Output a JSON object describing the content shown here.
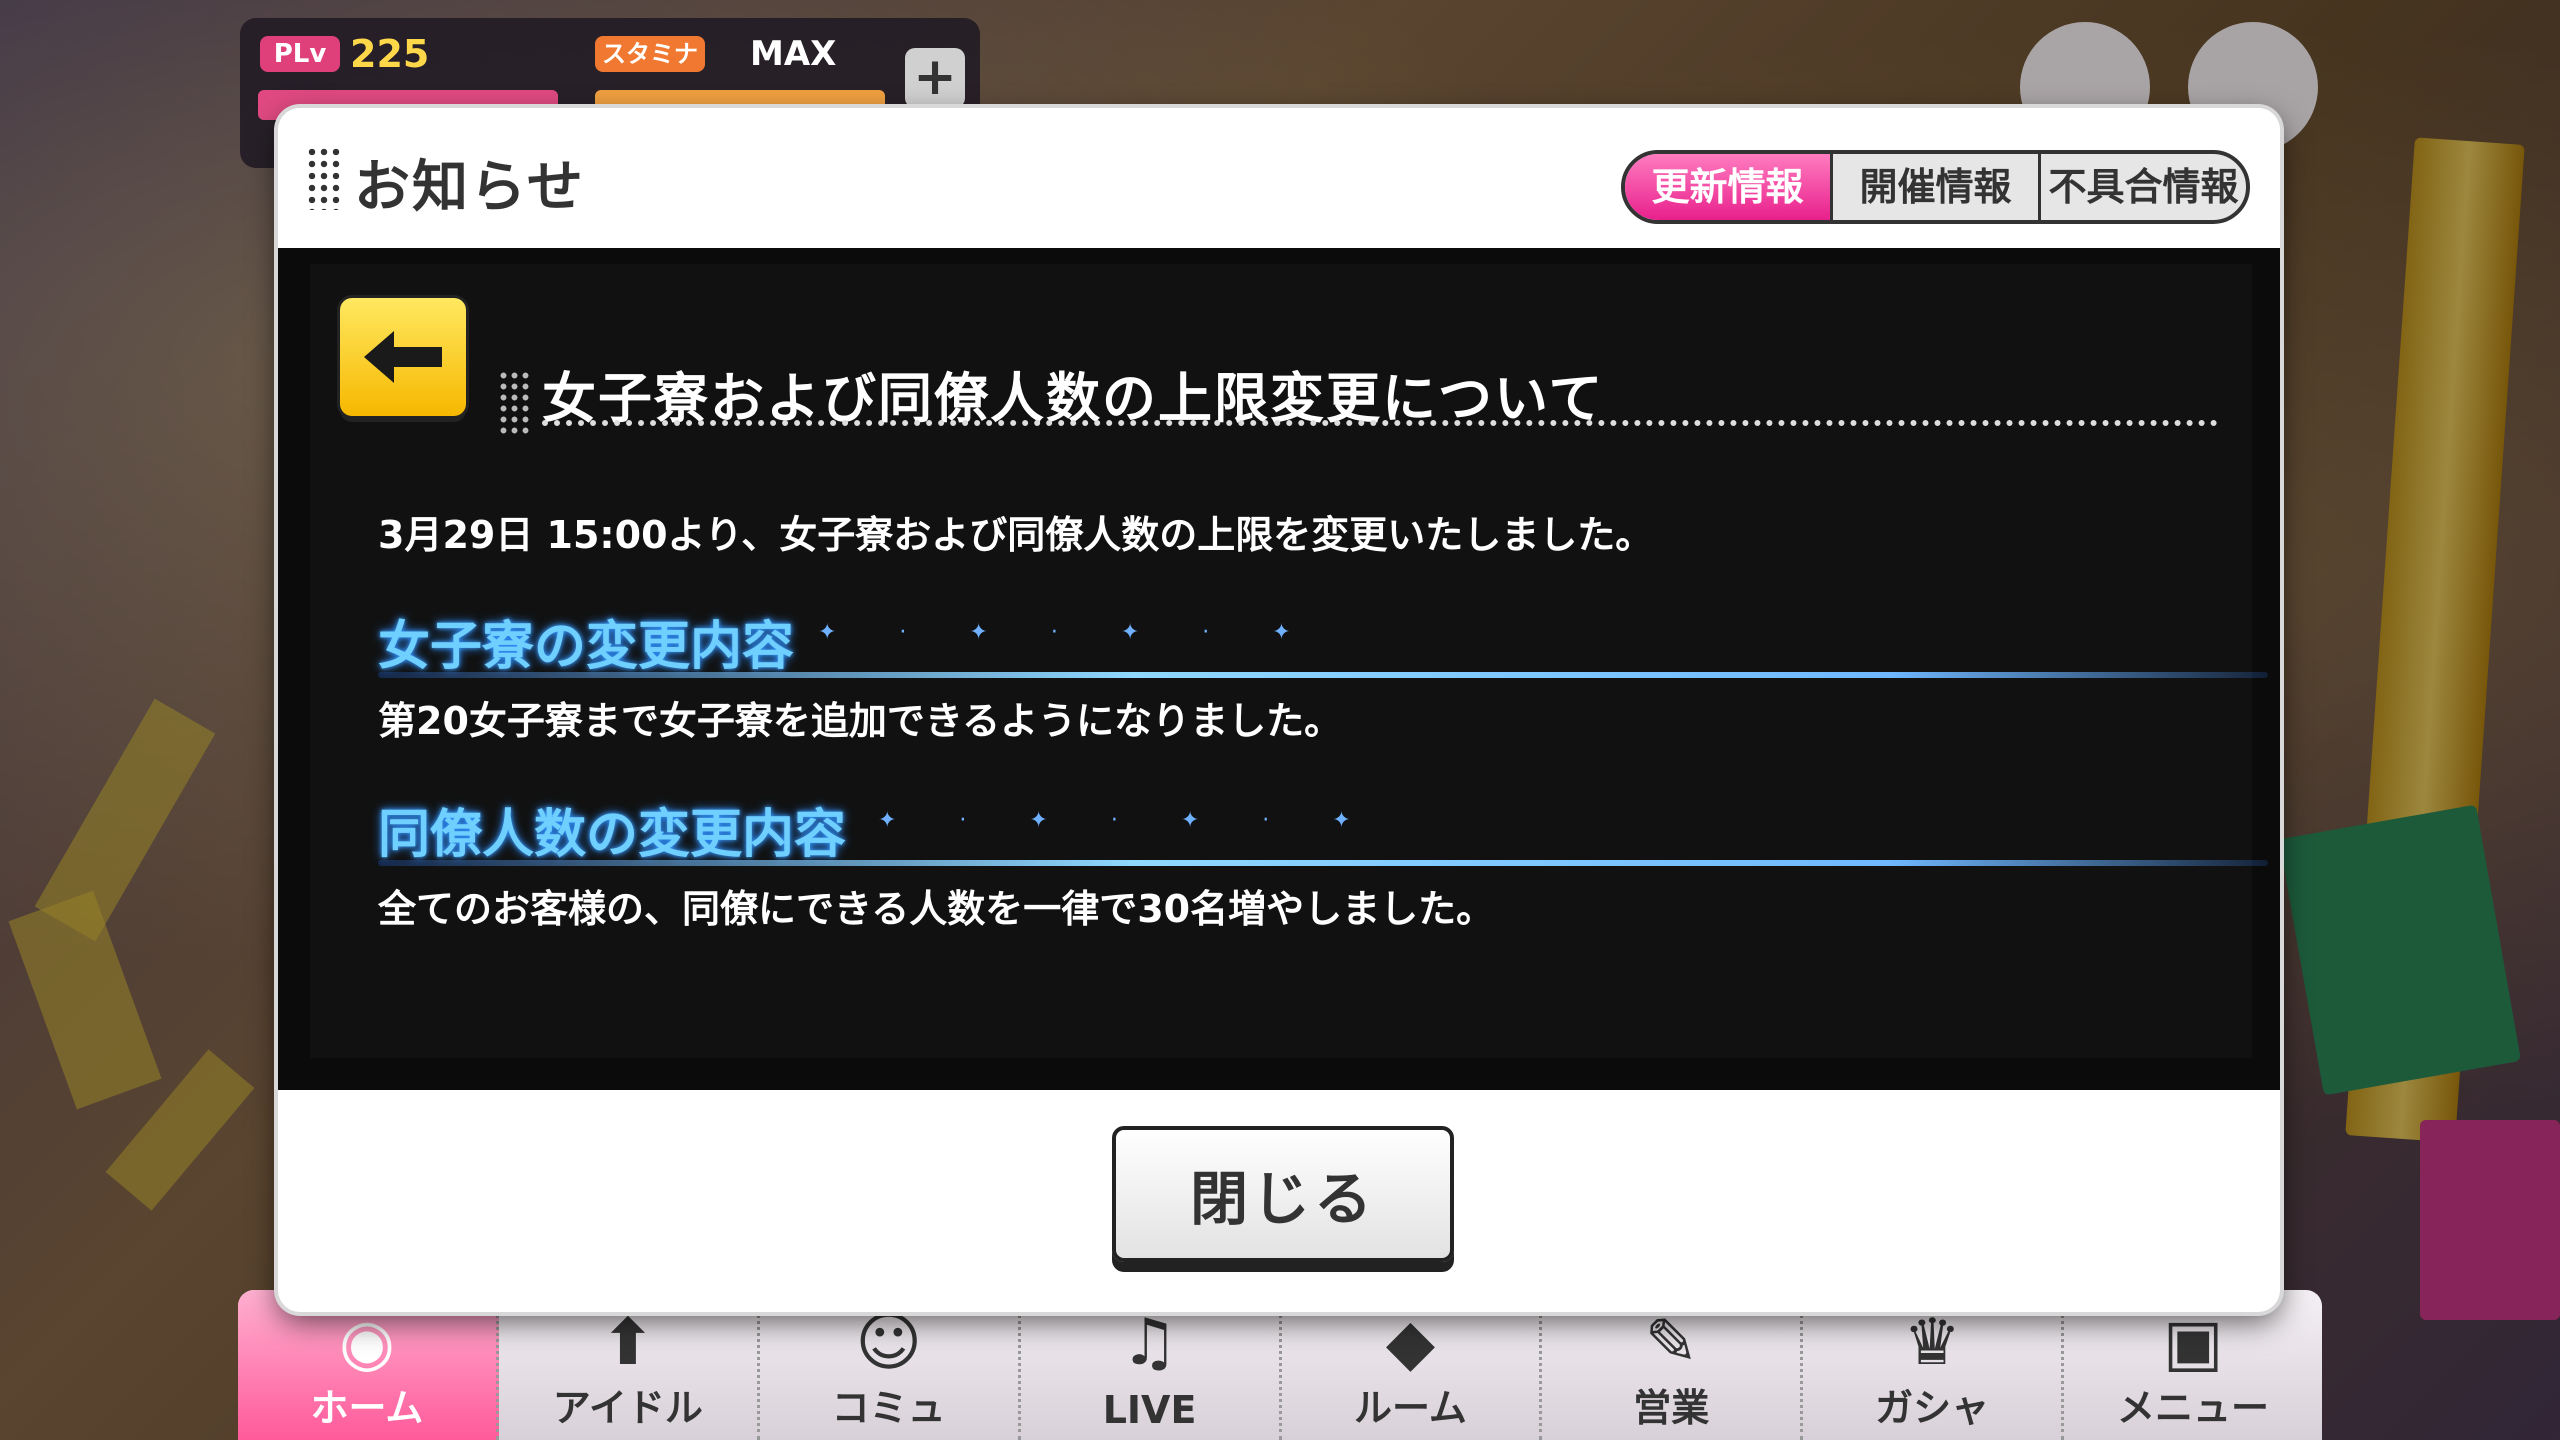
{
  "hud": {
    "plv_label": "PLv",
    "plv_value": "225",
    "stamina_label": "スタミナ",
    "stamina_value": "MAX",
    "plus_label": "+"
  },
  "modal": {
    "title": "お知らせ",
    "tabs": [
      {
        "label": "更新情報",
        "active": true
      },
      {
        "label": "開催情報",
        "active": false
      },
      {
        "label": "不具合情報",
        "active": false
      }
    ],
    "article": {
      "title": "女子寮および同僚人数の上限変更について",
      "intro": "3月29日 15:00より、女子寮および同僚人数の上限を変更いたしました。",
      "sections": [
        {
          "heading": "女子寮の変更内容",
          "text": "第20女子寮まで女子寮を追加できるようになりました。"
        },
        {
          "heading": "同僚人数の変更内容",
          "text": "全てのお客様の、同僚にできる人数を一律で30名増やしました。"
        }
      ]
    },
    "close_label": "閉じる"
  },
  "nav": {
    "items": [
      {
        "label": "ホーム",
        "icon": "home-icon"
      },
      {
        "label": "アイドル",
        "icon": "idol-icon"
      },
      {
        "label": "コミュ",
        "icon": "commu-icon"
      },
      {
        "label": "LIVE",
        "icon": "live-icon"
      },
      {
        "label": "ルーム",
        "icon": "room-icon"
      },
      {
        "label": "営業",
        "icon": "business-icon"
      },
      {
        "label": "ガシャ",
        "icon": "gacha-icon"
      },
      {
        "label": "メニュー",
        "icon": "menu-icon"
      }
    ]
  },
  "colors": {
    "accent_pink": "#e8208c",
    "back_button_yellow": "#f6b800",
    "section_heading_blue": "#6fd0ff"
  }
}
